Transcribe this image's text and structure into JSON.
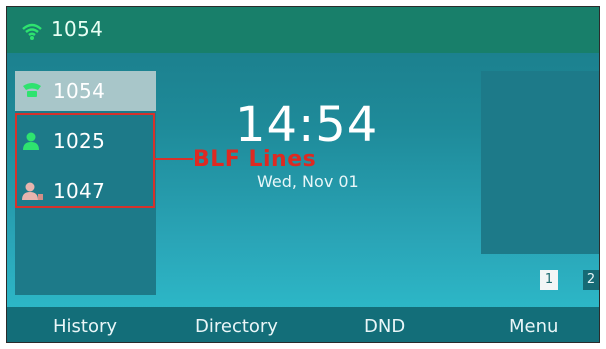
{
  "topbar": {
    "account": "1054",
    "icon": "signal-icon"
  },
  "lines": [
    {
      "label": "1054",
      "icon": "account-icon",
      "selected": true
    },
    {
      "label": "1025",
      "icon": "blf-idle-icon",
      "selected": false
    },
    {
      "label": "1047",
      "icon": "blf-busy-icon",
      "selected": false
    }
  ],
  "annotation": {
    "label": "BLF Lines",
    "color": "#dd2a22"
  },
  "clock": {
    "time": "14:54",
    "date": "Wed, Nov 01"
  },
  "pages": {
    "current": "1",
    "other": "2"
  },
  "softkeys": {
    "history": "History",
    "directory": "Directory",
    "dnd": "DND",
    "menu": "Menu"
  }
}
